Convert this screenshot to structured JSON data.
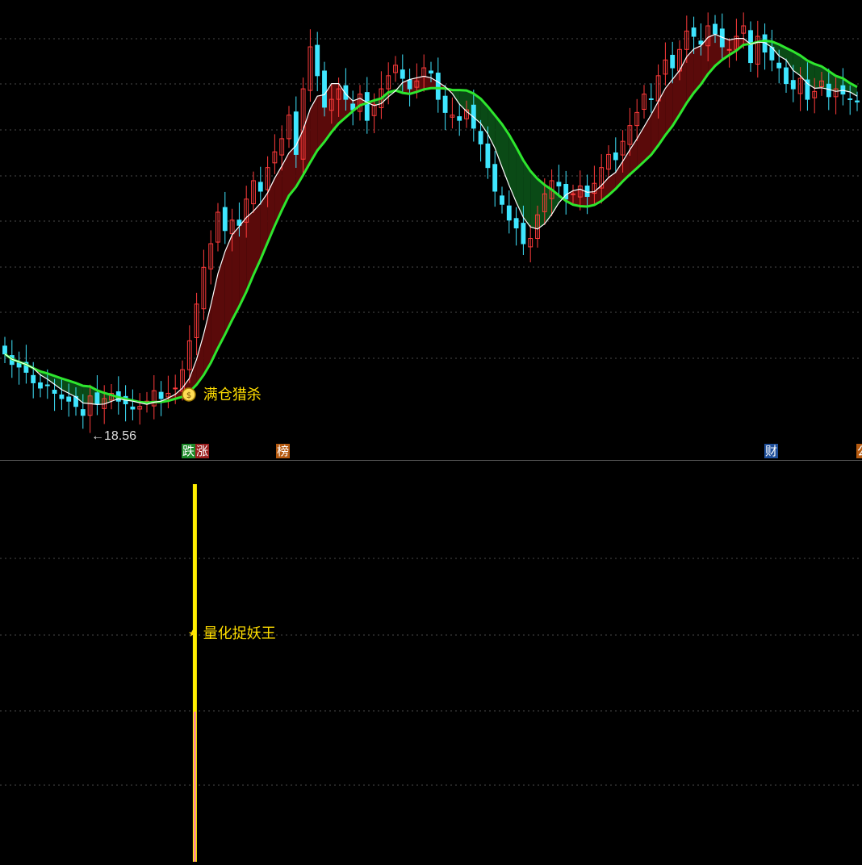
{
  "colors": {
    "background": "#000000",
    "grid": "#4a4a4a",
    "divider": "#5a5a5a",
    "up_candle": "#ff3b3b",
    "down_candle": "#3fe6ff",
    "ma_fast": "#ffffff",
    "ma_slow": "#2ee62e",
    "fill_up": "#5a0a0a",
    "fill_down": "#0a4a16",
    "signal_text": "#ffdd00",
    "low_price_text": "#dddddd",
    "indicator_text": "#ffdd00",
    "indicator_bar": "#ffee00",
    "indicator_bar_lower": "#ff66cc",
    "tag_green": "#1e8a2a",
    "tag_red": "#9a1f1f",
    "tag_orange": "#b55a10",
    "tag_blue": "#1f4f9a"
  },
  "main_panel": {
    "buy_signal": {
      "icon": "money-bag-icon",
      "label": "满仓猎杀"
    },
    "low_price_label": "←18.56",
    "event_tags": [
      {
        "text": "跌",
        "color": "tag_green"
      },
      {
        "text": "涨",
        "color": "tag_red"
      },
      {
        "text": "榜",
        "color": "tag_orange"
      },
      {
        "text": "财",
        "color": "tag_blue"
      },
      {
        "text": "公",
        "color": "tag_orange"
      }
    ]
  },
  "indicator_panel": {
    "name_icon": "star-icon",
    "name": "量化捉妖王"
  },
  "chart_data": [
    {
      "type": "candlestick",
      "title": "",
      "grid": true,
      "low_marker": 18.56,
      "series": [
        {
          "name": "",
          "kind": "candles",
          "close": [
            20.9,
            20.5,
            20.4,
            20.2,
            19.8,
            19.6,
            19.7,
            19.4,
            19.2,
            19.1,
            18.9,
            18.56,
            19.3,
            19.0,
            19.2,
            19.4,
            19.1,
            19.0,
            18.8,
            18.9,
            19.1,
            19.5,
            19.2,
            19.4,
            19.6,
            20.3,
            21.4,
            22.8,
            24.2,
            25.1,
            26.3,
            25.6,
            26.0,
            25.8,
            26.8,
            27.5,
            27.1,
            28.0,
            28.6,
            29.1,
            30.0,
            28.5,
            31.0,
            32.6,
            31.5,
            30.3,
            30.6,
            31.0,
            30.6,
            30.2,
            30.8,
            29.8,
            30.4,
            31.0,
            31.5,
            31.9,
            31.4,
            31.0,
            31.3,
            31.8,
            31.6,
            30.6,
            30.1,
            30.0,
            29.8,
            30.2,
            29.5,
            28.9,
            28.0,
            27.1,
            26.6,
            26.0,
            25.7,
            25.1,
            25.3,
            26.2,
            27.0,
            27.5,
            27.3,
            26.8,
            27.0,
            27.3,
            26.9,
            27.4,
            28.0,
            28.5,
            28.3,
            29.0,
            29.6,
            30.1,
            30.8,
            30.6,
            31.5,
            32.1,
            31.8,
            32.5,
            33.2,
            33.0,
            32.7,
            33.4,
            33.1,
            32.6,
            32.5,
            33.0,
            33.4,
            32.0,
            33.0,
            32.4,
            32.1,
            31.8,
            31.2,
            31.0,
            31.4,
            30.6,
            30.9,
            31.3,
            30.7,
            31.0,
            30.8,
            30.6,
            30.5
          ]
        },
        {
          "name": "",
          "kind": "ma_fast"
        },
        {
          "name": "",
          "kind": "ma_slow"
        }
      ]
    },
    {
      "type": "bar",
      "title": "量化捉妖王",
      "grid": true,
      "signal_index": 23,
      "values": [
        1
      ]
    }
  ]
}
